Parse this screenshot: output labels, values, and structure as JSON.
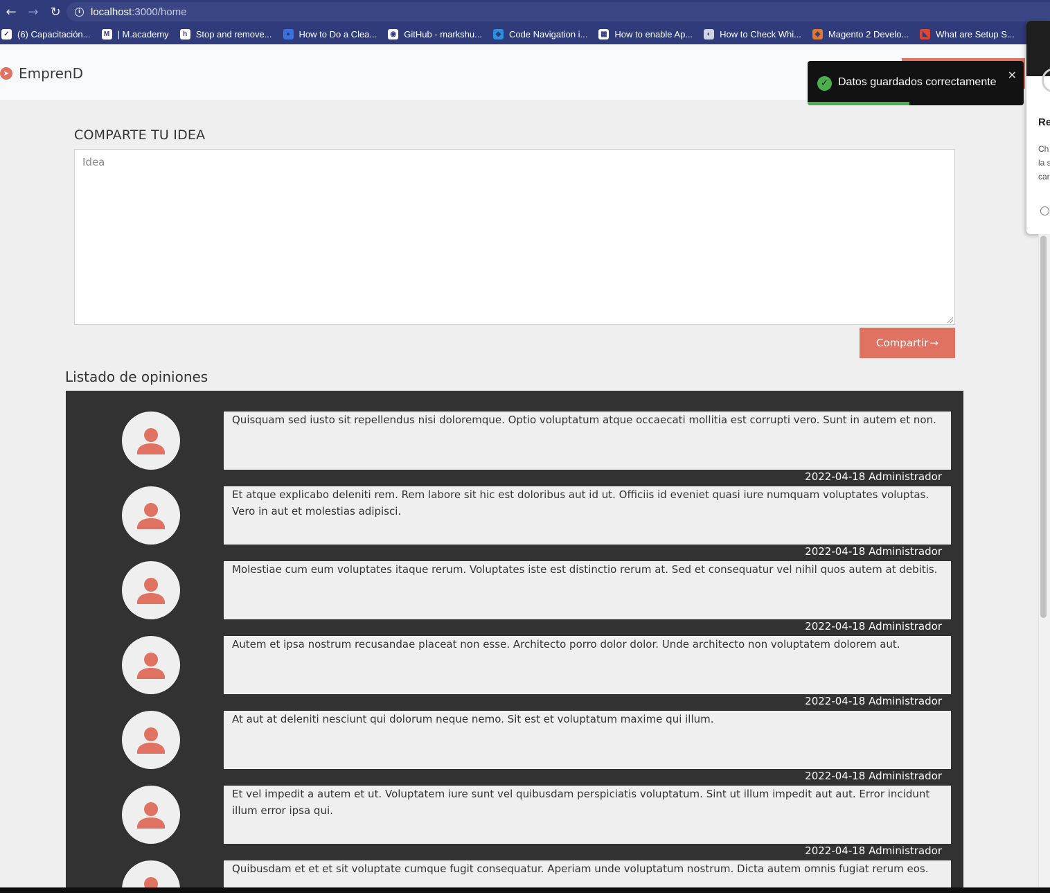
{
  "browser": {
    "url_host": "localhost",
    "url_path": ":3000/home",
    "bookmarks": [
      {
        "label": "(6) Capacitación...",
        "icon": "check-icon",
        "color": "#ffffff"
      },
      {
        "label": "| M.academy",
        "icon": "m-icon",
        "color": "#ffffff"
      },
      {
        "label": "Stop and remove...",
        "icon": "h-icon",
        "color": "#ffffff"
      },
      {
        "label": "How to Do a Clea...",
        "icon": "circle-icon",
        "color": "#3a73e0"
      },
      {
        "label": "GitHub - markshu...",
        "icon": "github-icon",
        "color": "#ffffff"
      },
      {
        "label": "Code Navigation i...",
        "icon": "vscode-icon",
        "color": "#2d8fe0"
      },
      {
        "label": "How to enable Ap...",
        "icon": "chart-icon",
        "color": "#ffffff"
      },
      {
        "label": "How to Check Whi...",
        "icon": "bulb-icon",
        "color": "#cfd3e6"
      },
      {
        "label": "Magento 2 Develo...",
        "icon": "magento-icon",
        "color": "#e0792f"
      },
      {
        "label": "What are Setup S...",
        "icon": "magento-red-icon",
        "color": "#e0452f"
      }
    ]
  },
  "app": {
    "brand": "EmprenD",
    "accent": "#e07262"
  },
  "toast": {
    "message": "Datos guardados correctamente",
    "close": "✕",
    "progress": 0.47
  },
  "side_panel": {
    "title": "Re",
    "lines": [
      "Ch",
      "la s",
      "car"
    ]
  },
  "share": {
    "title": "COMPARTE TU IDEA",
    "placeholder": "Idea",
    "button_label": "Compartir",
    "button_arrow": "→"
  },
  "opinions": {
    "title": "Listado de opiniones",
    "items": [
      {
        "text": "Quisquam sed iusto sit repellendus nisi doloremque. Optio voluptatum atque occaecati mollitia est corrupti vero. Sunt in autem et non.",
        "meta": "2022-04-18 Administrador"
      },
      {
        "text": "Et atque explicabo deleniti rem. Rem labore sit hic est doloribus aut id ut. Officiis id eveniet quasi iure numquam voluptates voluptas. Vero in aut et molestias adipisci.",
        "meta": "2022-04-18 Administrador"
      },
      {
        "text": "Molestiae cum eum voluptates itaque rerum. Voluptates iste est distinctio rerum at. Sed et consequatur vel nihil quos autem at debitis.",
        "meta": "2022-04-18 Administrador"
      },
      {
        "text": "Autem et ipsa nostrum recusandae placeat non esse. Architecto porro dolor dolor. Unde architecto non voluptatem dolorem aut.",
        "meta": "2022-04-18 Administrador"
      },
      {
        "text": "At aut at deleniti nesciunt qui dolorum neque nemo. Sit est et voluptatum maxime qui illum.",
        "meta": "2022-04-18 Administrador"
      },
      {
        "text": "Et vel impedit a autem et ut. Voluptatem iure sunt vel quibusdam perspiciatis voluptatum. Sint ut illum impedit aut aut. Error incidunt illum error ipsa qui.",
        "meta": "2022-04-18 Administrador"
      },
      {
        "text": "Quibusdam et et et sit voluptate cumque fugit consequatur. Aperiam unde voluptatum nostrum. Dicta autem omnis fugiat rerum eos.",
        "meta": ""
      }
    ]
  }
}
